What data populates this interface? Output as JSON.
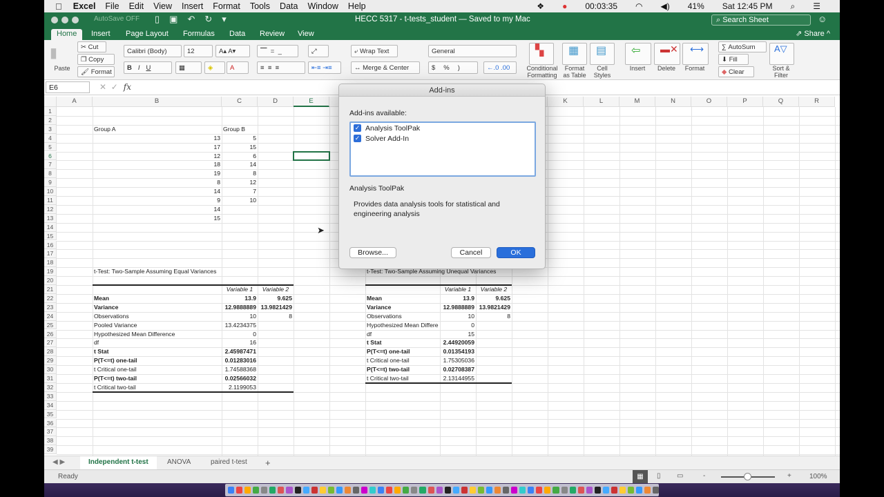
{
  "menubar": {
    "app": "Excel",
    "items": [
      "File",
      "Edit",
      "View",
      "Insert",
      "Format",
      "Tools",
      "Data",
      "Window",
      "Help"
    ],
    "recording_time": "00:03:35",
    "battery": "41%",
    "clock": "Sat 12:45 PM"
  },
  "titlebar": {
    "autosave": "AutoSave",
    "autosave_state": "OFF",
    "title": "HECC 5317 - t-tests_student — Saved to my Mac",
    "search_placeholder": "Search Sheet"
  },
  "ribbon_tabs": [
    "Home",
    "Insert",
    "Page Layout",
    "Formulas",
    "Data",
    "Review",
    "View"
  ],
  "share": "Share",
  "ribbon": {
    "paste": "Paste",
    "cut": "Cut",
    "copy": "Copy",
    "format_painter": "Format",
    "font": "Calibri (Body)",
    "size": "12",
    "wrap": "Wrap Text",
    "merge": "Merge & Center",
    "numfmt": "General",
    "cond1": "Conditional",
    "cond2": "Formatting",
    "fat1": "Format",
    "fat2": "as Table",
    "cs1": "Cell",
    "cs2": "Styles",
    "insert": "Insert",
    "delete": "Delete",
    "format": "Format",
    "autosum": "AutoSum",
    "fill": "Fill",
    "clear": "Clear",
    "sort1": "Sort &",
    "sort2": "Filter",
    "bold": "B",
    "italic": "I",
    "underline": "U",
    "currency": "$",
    "percent": "%"
  },
  "formula_bar": {
    "name_box": "E6",
    "fx": "fx",
    "value": ""
  },
  "columns": [
    "A",
    "B",
    "C",
    "D",
    "E",
    "F",
    "G",
    "H",
    "I",
    "J",
    "K",
    "L",
    "M",
    "N",
    "O",
    "P",
    "Q",
    "R"
  ],
  "cells": [
    [
      3,
      "B",
      "Group A",
      ""
    ],
    [
      3,
      "C",
      "Group B",
      ""
    ],
    [
      4,
      "B",
      "13",
      "r"
    ],
    [
      4,
      "C",
      "5",
      "r"
    ],
    [
      5,
      "B",
      "17",
      "r"
    ],
    [
      5,
      "C",
      "15",
      "r"
    ],
    [
      6,
      "B",
      "12",
      "r"
    ],
    [
      6,
      "C",
      "6",
      "r"
    ],
    [
      7,
      "B",
      "18",
      "r"
    ],
    [
      7,
      "C",
      "14",
      "r"
    ],
    [
      8,
      "B",
      "19",
      "r"
    ],
    [
      8,
      "C",
      "8",
      "r"
    ],
    [
      9,
      "B",
      "8",
      "r"
    ],
    [
      9,
      "C",
      "12",
      "r"
    ],
    [
      10,
      "B",
      "14",
      "r"
    ],
    [
      10,
      "C",
      "7",
      "r"
    ],
    [
      11,
      "B",
      "9",
      "r"
    ],
    [
      11,
      "C",
      "10",
      "r"
    ],
    [
      12,
      "B",
      "14",
      "r"
    ],
    [
      13,
      "B",
      "15",
      "r"
    ],
    [
      19,
      "B",
      "t-Test: Two-Sample Assuming Equal Variances",
      ""
    ],
    [
      21,
      "C",
      "Variable 1",
      "i"
    ],
    [
      21,
      "D",
      "Variable 2",
      "i"
    ],
    [
      22,
      "B",
      "Mean",
      "b"
    ],
    [
      22,
      "C",
      "13.9",
      "rb"
    ],
    [
      22,
      "D",
      "9.625",
      "rb"
    ],
    [
      23,
      "B",
      "Variance",
      "b"
    ],
    [
      23,
      "C",
      "12.9888889",
      "rb"
    ],
    [
      23,
      "D",
      "13.9821429",
      "rb"
    ],
    [
      24,
      "B",
      "Observations",
      ""
    ],
    [
      24,
      "C",
      "10",
      "r"
    ],
    [
      24,
      "D",
      "8",
      "r"
    ],
    [
      25,
      "B",
      "Pooled Variance",
      ""
    ],
    [
      25,
      "C",
      "13.4234375",
      "r"
    ],
    [
      26,
      "B",
      "Hypothesized Mean Difference",
      ""
    ],
    [
      26,
      "C",
      "0",
      "r"
    ],
    [
      27,
      "B",
      "df",
      ""
    ],
    [
      27,
      "C",
      "16",
      "r"
    ],
    [
      28,
      "B",
      "t Stat",
      "b"
    ],
    [
      28,
      "C",
      "2.45987471",
      "rb"
    ],
    [
      29,
      "B",
      "P(T<=t) one-tail",
      "b"
    ],
    [
      29,
      "C",
      "0.01283016",
      "rb"
    ],
    [
      30,
      "B",
      "t Critical one-tail",
      ""
    ],
    [
      30,
      "C",
      "1.74588368",
      "r"
    ],
    [
      31,
      "B",
      "P(T<=t) two-tail",
      "b"
    ],
    [
      31,
      "C",
      "0.02566032",
      "rb"
    ],
    [
      32,
      "B",
      "t Critical two-tail",
      ""
    ],
    [
      32,
      "C",
      "2.1199053",
      "r"
    ],
    [
      19,
      "G",
      "t-Test: Two-Sample Assuming Unequal Variances",
      ""
    ],
    [
      21,
      "H",
      "Variable 1",
      "i"
    ],
    [
      21,
      "I",
      "Variable 2",
      "i"
    ],
    [
      22,
      "G",
      "Mean",
      "b"
    ],
    [
      22,
      "H",
      "13.9",
      "rb"
    ],
    [
      22,
      "I",
      "9.625",
      "rb"
    ],
    [
      23,
      "G",
      "Variance",
      "b"
    ],
    [
      23,
      "H",
      "12.9888889",
      "rb"
    ],
    [
      23,
      "I",
      "13.9821429",
      "rb"
    ],
    [
      24,
      "G",
      "Observations",
      ""
    ],
    [
      24,
      "H",
      "10",
      "r"
    ],
    [
      24,
      "I",
      "8",
      "r"
    ],
    [
      25,
      "G",
      "Hypothesized Mean Differe",
      ""
    ],
    [
      25,
      "H",
      "0",
      "r"
    ],
    [
      26,
      "G",
      "df",
      ""
    ],
    [
      26,
      "H",
      "15",
      "r"
    ],
    [
      27,
      "G",
      "t Stat",
      "b"
    ],
    [
      27,
      "H",
      "2.44920059",
      "rb"
    ],
    [
      28,
      "G",
      "P(T<=t) one-tail",
      "b"
    ],
    [
      28,
      "H",
      "0.01354193",
      "rb"
    ],
    [
      29,
      "G",
      "t Critical one-tail",
      ""
    ],
    [
      29,
      "H",
      "1.75305036",
      "r"
    ],
    [
      30,
      "G",
      "P(T<=t) two-tail",
      "b"
    ],
    [
      30,
      "H",
      "0.02708387",
      "rb"
    ],
    [
      31,
      "G",
      "t Critical two-tail",
      ""
    ],
    [
      31,
      "H",
      "2.13144955",
      "r"
    ]
  ],
  "dialog": {
    "title": "Add-ins",
    "available_label": "Add-ins available:",
    "items": [
      {
        "label": "Analysis ToolPak",
        "checked": true
      },
      {
        "label": "Solver Add-In",
        "checked": true
      }
    ],
    "selected_name": "Analysis ToolPak",
    "description": "Provides data analysis tools for statistical and engineering analysis",
    "browse": "Browse...",
    "cancel": "Cancel",
    "ok": "OK"
  },
  "sheet_tabs": [
    "Independent t-test",
    "ANOVA",
    "paired t-test"
  ],
  "status": {
    "ready": "Ready",
    "zoom": "100%"
  }
}
